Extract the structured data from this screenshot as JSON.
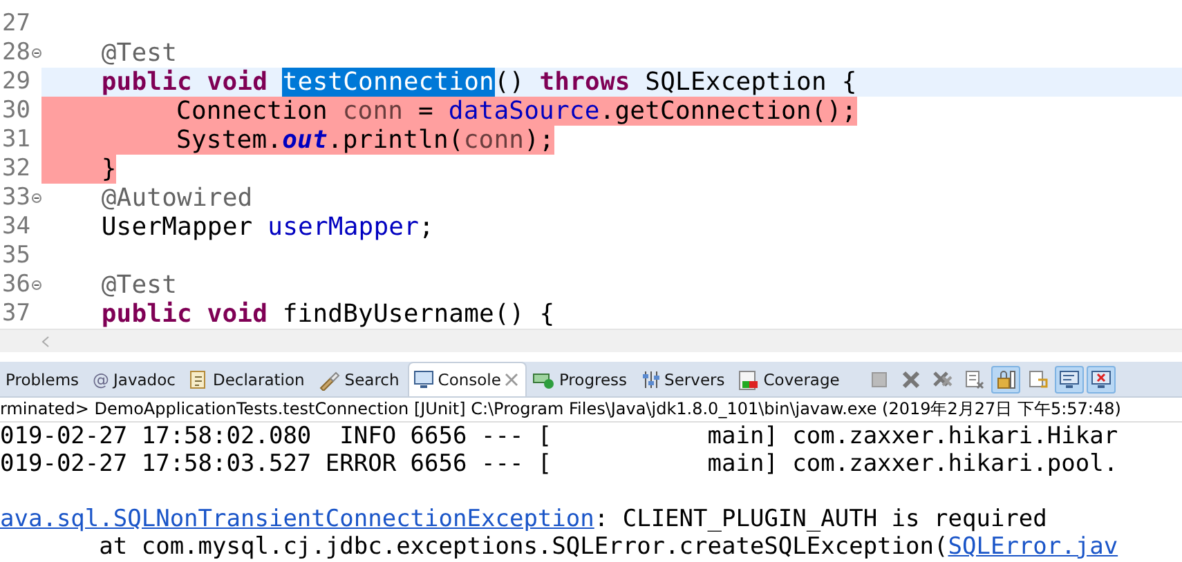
{
  "editor": {
    "lines": [
      {
        "number": "27",
        "kind": "member",
        "fold": false,
        "current": false,
        "error": false
      },
      {
        "number": "28",
        "kind": "member",
        "fold": true,
        "current": false,
        "error": false,
        "tokens": [
          {
            "kind": "annotation",
            "text": "@Test"
          }
        ]
      },
      {
        "number": "29",
        "kind": "member",
        "fold": false,
        "current": true,
        "error": false,
        "tokens": [
          {
            "kind": "keyword",
            "text": "public"
          },
          {
            "kind": "keyword",
            "text": "void"
          },
          {
            "kind": "selection",
            "text": "testConnection"
          },
          {
            "kind": "plain",
            "text": "()"
          },
          {
            "kind": "keyword",
            "text": "throws"
          },
          {
            "kind": "plain",
            "text": "SQLException {"
          }
        ]
      },
      {
        "number": "30",
        "kind": "statement",
        "fold": false,
        "current": false,
        "error": true,
        "tokens": [
          {
            "kind": "plain",
            "text": "Connection "
          },
          {
            "kind": "local",
            "text": "conn"
          },
          {
            "kind": "plain",
            "text": " = "
          },
          {
            "kind": "field",
            "text": "dataSource"
          },
          {
            "kind": "plain",
            "text": ".getConnection();"
          }
        ]
      },
      {
        "number": "31",
        "kind": "statement",
        "fold": false,
        "current": false,
        "error": true,
        "tokens": [
          {
            "kind": "plain",
            "text": "System."
          },
          {
            "kind": "static",
            "text": "out"
          },
          {
            "kind": "plain",
            "text": ".println("
          },
          {
            "kind": "local",
            "text": "conn"
          },
          {
            "kind": "plain",
            "text": ");"
          }
        ]
      },
      {
        "number": "32",
        "kind": "member",
        "fold": false,
        "current": false,
        "error": true,
        "tokens": [
          {
            "kind": "plain",
            "text": "}"
          }
        ]
      },
      {
        "number": "33",
        "kind": "member",
        "fold": true,
        "current": false,
        "error": false,
        "tokens": [
          {
            "kind": "annotation",
            "text": "@Autowired"
          }
        ]
      },
      {
        "number": "34",
        "kind": "member",
        "fold": false,
        "current": false,
        "error": false,
        "tokens": [
          {
            "kind": "plain",
            "text": "UserMapper "
          },
          {
            "kind": "field",
            "text": "userMapper"
          },
          {
            "kind": "plain",
            "text": ";"
          }
        ]
      },
      {
        "number": "35",
        "kind": "member",
        "fold": false,
        "current": false,
        "error": false
      },
      {
        "number": "36",
        "kind": "member",
        "fold": true,
        "current": false,
        "error": false,
        "tokens": [
          {
            "kind": "annotation",
            "text": "@Test"
          }
        ]
      },
      {
        "number": "37",
        "kind": "member",
        "fold": false,
        "current": false,
        "error": false,
        "tokens": [
          {
            "kind": "keyword",
            "text": "public"
          },
          {
            "kind": "keyword",
            "text": "void"
          },
          {
            "kind": "plain",
            "text": "findByUsername() {"
          }
        ]
      }
    ]
  },
  "tabs": [
    {
      "label": "Problems",
      "selected": false
    },
    {
      "label": "Javadoc",
      "icon_text": "@",
      "selected": false
    },
    {
      "label": "Declaration",
      "selected": false
    },
    {
      "label": "Search",
      "selected": false
    },
    {
      "label": "Console",
      "selected": true
    },
    {
      "label": "Progress",
      "selected": false
    },
    {
      "label": "Servers",
      "selected": false
    },
    {
      "label": "Coverage",
      "selected": false
    }
  ],
  "toolbar": [
    {
      "selected": false
    },
    {
      "selected": false
    },
    {
      "selected": false
    },
    {
      "selected": false
    },
    {
      "selected": true
    },
    {
      "selected": false
    },
    {
      "selected": true
    },
    {
      "selected": true
    }
  ],
  "console": {
    "process": "rminated> DemoApplicationTests.testConnection [JUnit] C:\\Program Files\\Java\\jdk1.8.0_101\\bin\\javaw.exe (2019年2月27日 下午5:57:48)",
    "lines": [
      {
        "kind": "text",
        "segments": [
          {
            "kind": "text",
            "text": "019-02-27 17:58:02.080  INFO 6656 --- [           main] com.zaxxer.hikari.Hikar"
          }
        ]
      },
      {
        "kind": "text",
        "segments": [
          {
            "kind": "text",
            "text": "019-02-27 17:58:03.527 ERROR 6656 --- [           main] com.zaxxer.hikari.pool."
          }
        ]
      },
      {
        "kind": "blank"
      },
      {
        "kind": "text",
        "segments": [
          {
            "kind": "link",
            "text": "ava.sql.SQLNonTransientConnectionException"
          },
          {
            "kind": "text",
            "text": ": CLIENT_PLUGIN_AUTH is required"
          }
        ]
      },
      {
        "kind": "text",
        "segments": [
          {
            "kind": "text",
            "text": "       at com.mysql.cj.jdbc.exceptions.SQLError.createSQLException("
          },
          {
            "kind": "link",
            "text": "SQLError.jav"
          }
        ]
      }
    ]
  }
}
